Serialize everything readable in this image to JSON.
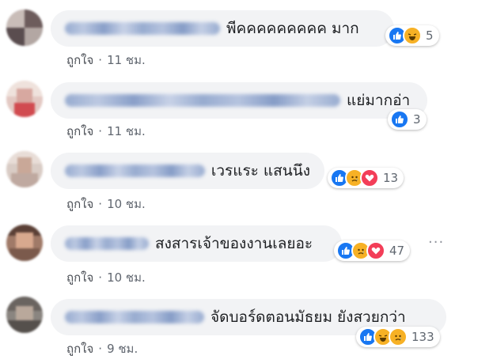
{
  "like_label": "ถูกใจ",
  "separator": "·",
  "more_label": "···",
  "comments": [
    {
      "text": "พีคคคคคคคคค มาก",
      "time": "11 ชม.",
      "reactions": [
        "like",
        "haha"
      ],
      "count": "5"
    },
    {
      "text": "แย่มากอ่า",
      "time": "11 ชม.",
      "reactions": [
        "like"
      ],
      "count": "3"
    },
    {
      "text": "เวรแระ แสนนึง",
      "time": "10 ชม.",
      "reactions": [
        "like",
        "sad",
        "love"
      ],
      "count": "13"
    },
    {
      "text": "สงสารเจ้าของงานเลยอะ",
      "time": "10 ชม.",
      "reactions": [
        "like",
        "sad",
        "love"
      ],
      "count": "47"
    },
    {
      "text": "จัดบอร์ดตอนมัธยม ยังสวยกว่า",
      "time": "9 ชม.",
      "reactions": [
        "like",
        "haha",
        "sad"
      ],
      "count": "133"
    }
  ],
  "colors": {
    "like": "#1877f2",
    "haha": "#f7b125",
    "sad": "#f7b125",
    "love": "#f33e58",
    "bubble": "#f2f3f5"
  }
}
